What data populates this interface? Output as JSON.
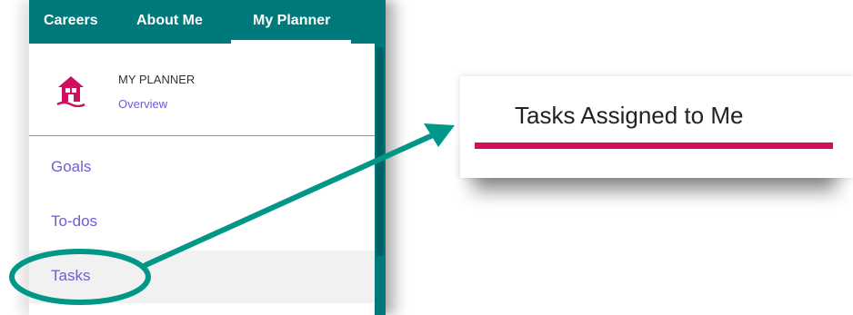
{
  "nav": {
    "careers": "Careers",
    "about_me": "About Me",
    "my_planner": "My Planner"
  },
  "planner": {
    "title": "MY PLANNER",
    "overview_link": "Overview",
    "icon": "home-icon"
  },
  "menu": {
    "items": [
      {
        "label": "Goals"
      },
      {
        "label": "To-dos"
      },
      {
        "label": "Tasks",
        "selected": true
      }
    ]
  },
  "zoom": {
    "tab_label": "Tasks Assigned to Me"
  },
  "colors": {
    "nav_bg": "#00797c",
    "link": "#6b5fd3",
    "accent": "#d0105c",
    "annotation": "#009688"
  }
}
